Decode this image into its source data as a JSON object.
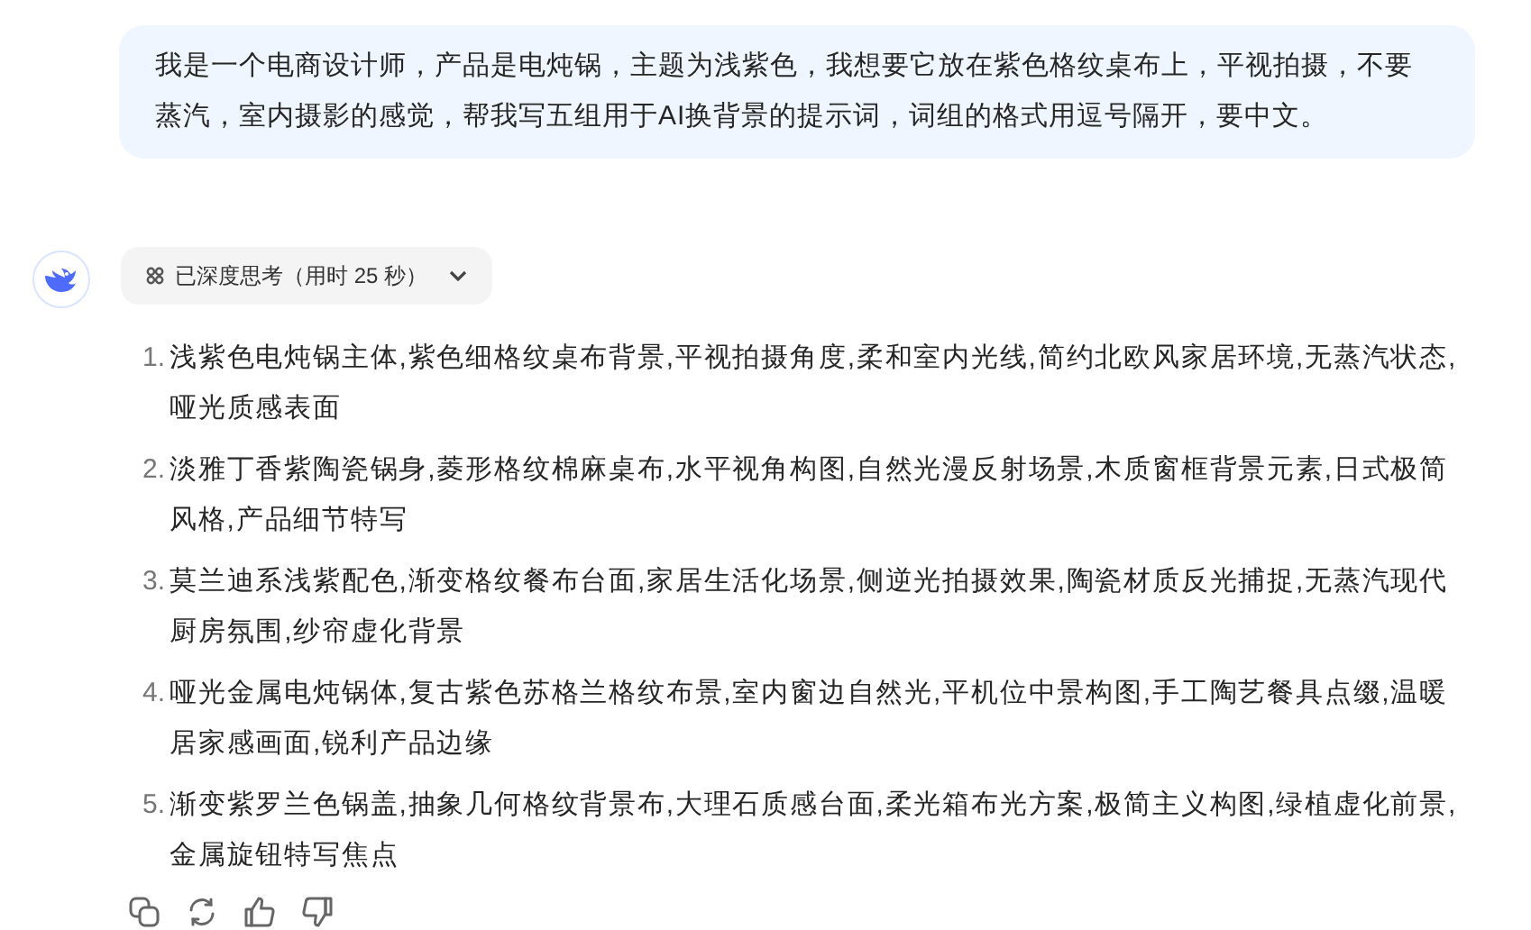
{
  "user_message": "我是一个电商设计师，产品是电炖锅，主题为浅紫色，我想要它放在紫色格纹桌布上，平视拍摄，不要蒸汽，室内摄影的感觉，帮我写五组用于AI换背景的提示词，词组的格式用逗号隔开，要中文。",
  "reply": {
    "thinking": {
      "label": "已深度思考（用时 25 秒）",
      "expanded": false
    },
    "items": [
      {
        "number": "1.",
        "text": "浅紫色电炖锅主体,紫色细格纹桌布背景,平视拍摄角度,柔和室内光线,简约北欧风家居环境,无蒸汽状态,哑光质感表面"
      },
      {
        "number": "2.",
        "text": "淡雅丁香紫陶瓷锅身,菱形格纹棉麻桌布,水平视角构图,自然光漫反射场景,木质窗框背景元素,日式极简风格,产品细节特写"
      },
      {
        "number": "3.",
        "text": "莫兰迪系浅紫配色,渐变格纹餐布台面,家居生活化场景,侧逆光拍摄效果,陶瓷材质反光捕捉,无蒸汽现代厨房氛围,纱帘虚化背景"
      },
      {
        "number": "4.",
        "text": "哑光金属电炖锅体,复古紫色苏格兰格纹布景,室内窗边自然光,平机位中景构图,手工陶艺餐具点缀,温暖居家感画面,锐利产品边缘"
      },
      {
        "number": "5.",
        "text": "渐变紫罗兰色锅盖,抽象几何格纹背景布,大理石质感台面,柔光箱布光方案,极简主义构图,绿植虚化前景,金属旋钮特写焦点"
      }
    ]
  }
}
